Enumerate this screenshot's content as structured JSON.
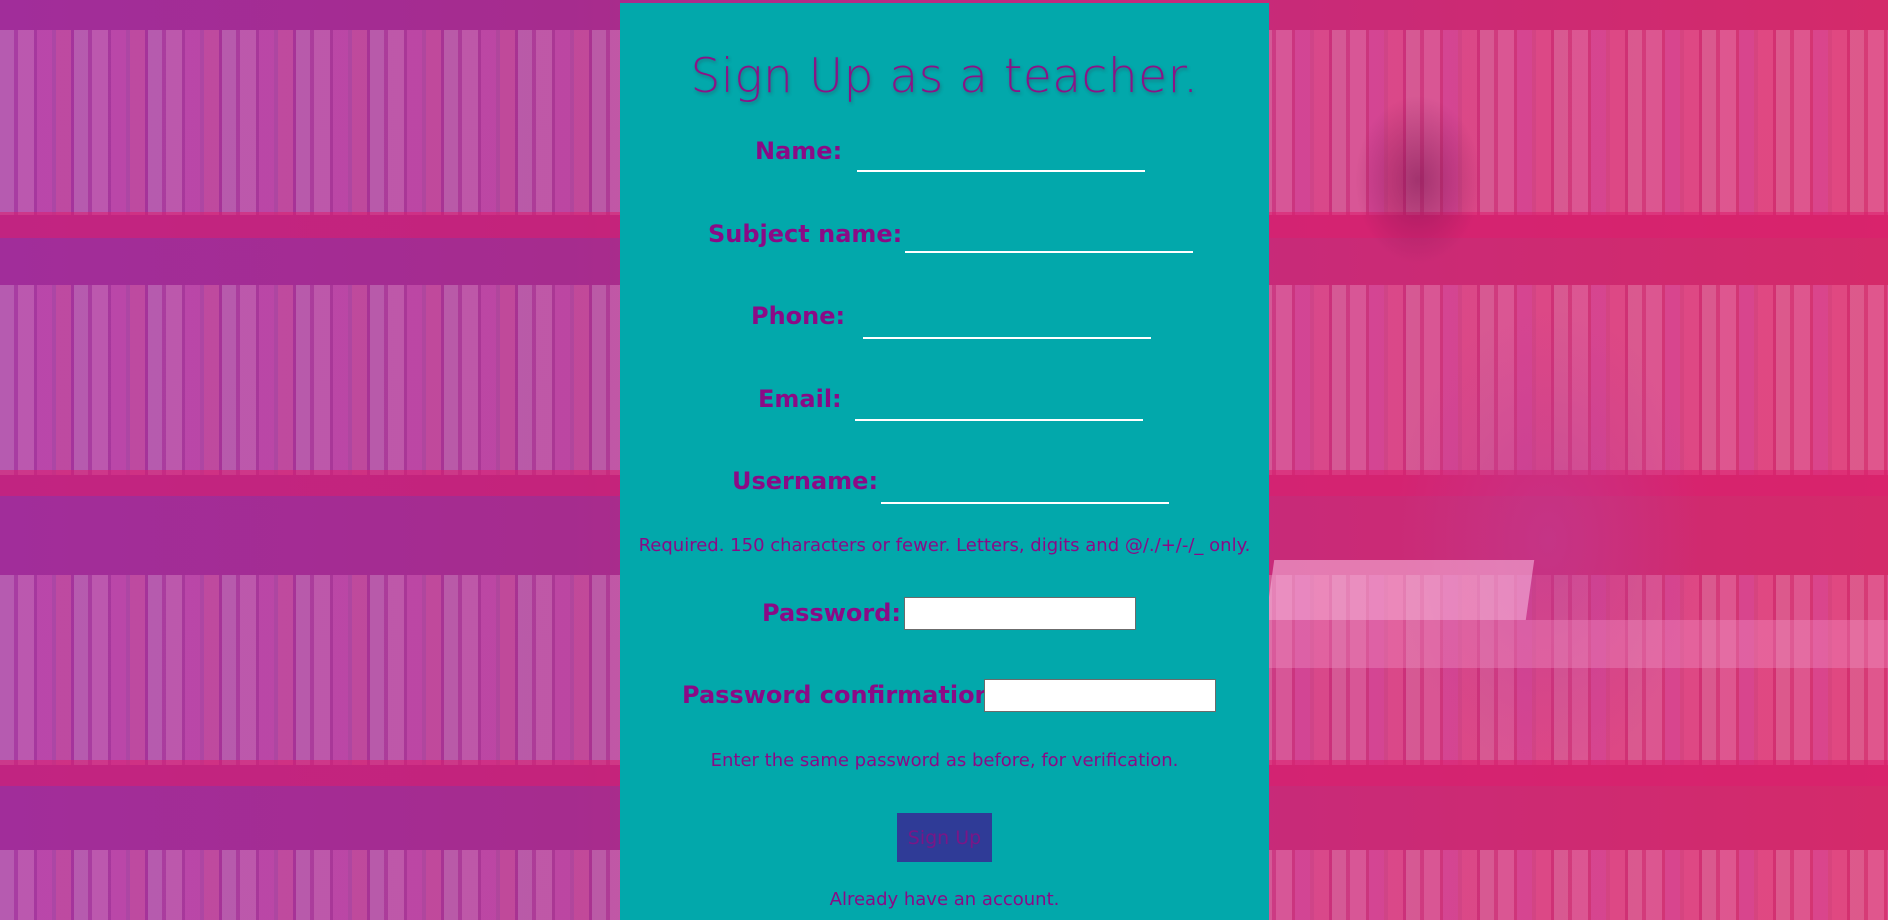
{
  "page": {
    "title": "Sign Up as a teacher."
  },
  "form": {
    "name_label": "Name:",
    "subject_label": "Subject name:",
    "phone_label": "Phone:",
    "email_label": "Email:",
    "username_label": "Username:",
    "username_help": "Required. 150 characters or fewer. Letters, digits and @/./+/-/_ only.",
    "password_label": "Password:",
    "password_confirm_label": "Password confirmation:",
    "password_confirm_help": "Enter the same password as before, for verification.",
    "name_value": "",
    "subject_value": "",
    "phone_value": "",
    "email_value": "",
    "username_value": "",
    "password_value": "",
    "password_confirm_value": ""
  },
  "actions": {
    "signup_label": "Sign Up",
    "login_link": "Already have an account."
  },
  "colors": {
    "panel": "#02a8ab",
    "text": "#8b0a86",
    "button": "#2f3b97",
    "background_overlay": "#c52a7c"
  }
}
